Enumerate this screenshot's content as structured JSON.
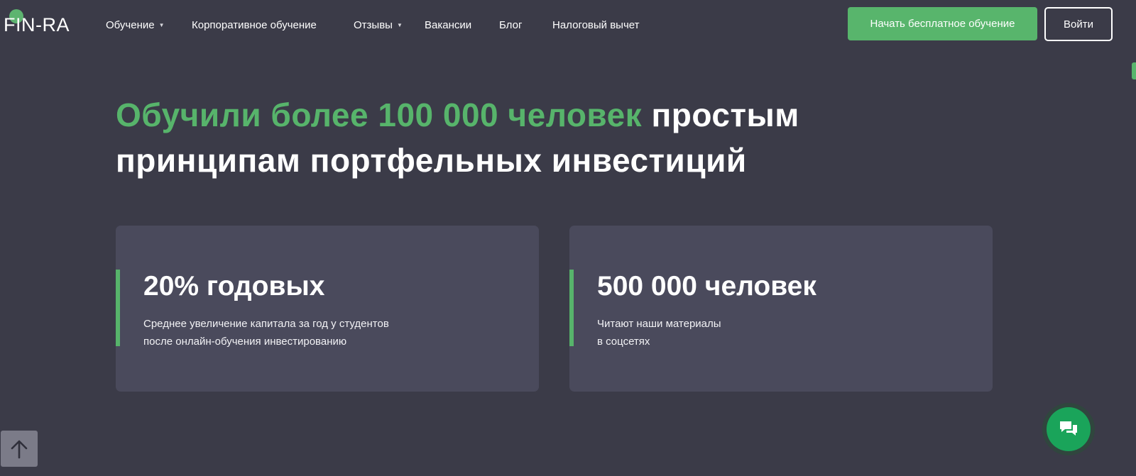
{
  "header": {
    "logo_text": "FIN-RA",
    "nav": [
      {
        "label": "Обучение",
        "has_dropdown": true
      },
      {
        "label": "Корпоративное обучение",
        "has_dropdown": false
      },
      {
        "label": "Отзывы",
        "has_dropdown": true
      },
      {
        "label": "Вакансии",
        "has_dropdown": false
      },
      {
        "label": "Блог",
        "has_dropdown": false
      },
      {
        "label": "Налоговый вычет",
        "has_dropdown": false
      }
    ],
    "cta_label": "Начать бесплатное обучение",
    "login_label": "Войти"
  },
  "hero": {
    "highlight": "Обучили более 100 000 человек",
    "rest": " простым принципам портфельных инвестиций"
  },
  "stats": [
    {
      "title": "20% годовых",
      "desc_line1": "Среднее увеличение капитала за год у студентов",
      "desc_line2": "после онлайн-обучения инвестированию"
    },
    {
      "title": "500 000 человек",
      "desc_line1": "Читают наши материалы",
      "desc_line2": "в соцсетях"
    }
  ],
  "widgets": {
    "scroll_top_icon": "arrow-up-icon",
    "chat_icon": "chat-bubbles-icon"
  },
  "colors": {
    "background": "#3b3b48",
    "accent_green": "#57b46b",
    "card_background": "#4a4a5c",
    "chat_green": "#1aa45a"
  }
}
